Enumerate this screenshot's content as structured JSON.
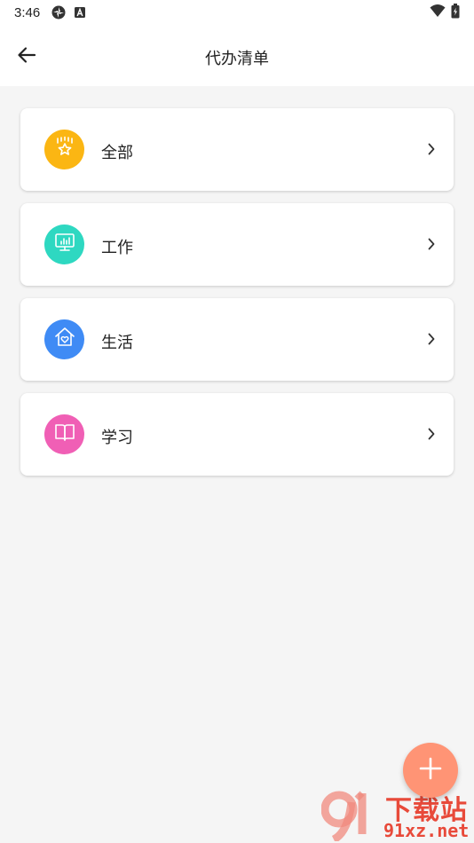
{
  "status_bar": {
    "time": "3:46",
    "icons": [
      "vpn-icon",
      "keyboard-a-icon",
      "wifi-icon",
      "battery-icon"
    ]
  },
  "app_bar": {
    "title": "代办清单",
    "back_icon": "arrow-left-icon"
  },
  "categories": [
    {
      "label": "全部",
      "icon": "crown-star-icon",
      "color": "#fbb613"
    },
    {
      "label": "工作",
      "icon": "monitor-chart-icon",
      "color": "#2ed8c1"
    },
    {
      "label": "生活",
      "icon": "house-heart-icon",
      "color": "#3f8bf5"
    },
    {
      "label": "学习",
      "icon": "open-book-icon",
      "color": "#f05fb5"
    }
  ],
  "fab": {
    "icon": "plus-icon",
    "color": "#ff9475"
  },
  "watermark": {
    "title": "下载站",
    "domain": "91xz.net"
  }
}
